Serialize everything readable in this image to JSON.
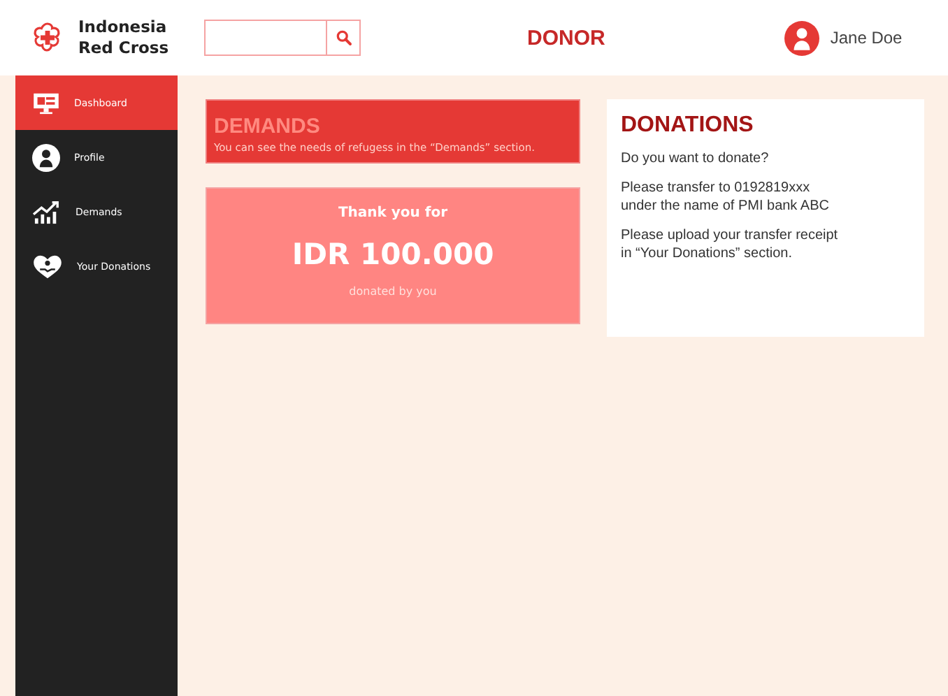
{
  "brand": {
    "line1": "Indonesia",
    "line2": "Red Cross"
  },
  "page_title": "DONOR",
  "user": {
    "name": "Jane Doe"
  },
  "sidebar": {
    "items": [
      {
        "label": "Dashboard",
        "kind": "monitor",
        "selected": true
      },
      {
        "label": "Profile",
        "kind": "person",
        "selected": false
      },
      {
        "label": "Demands",
        "kind": "chart",
        "selected": false
      },
      {
        "label": "Your Donations",
        "kind": "heart",
        "selected": false
      }
    ]
  },
  "demands_card": {
    "title": "DEMANDS",
    "text": "You can see the needs of refugess in the “Demands” section."
  },
  "thanks_card": {
    "intro": "Thank you for",
    "amount": "IDR 100.000",
    "note": "donated by you"
  },
  "donations_card": {
    "title": "DONATIONS",
    "paragraphs": [
      "Do you want to donate?",
      "Please transfer to 0192819xxx\nunder the name of PMI bank ABC",
      "Please upload your transfer receipt\nin “Your Donations” section."
    ]
  }
}
